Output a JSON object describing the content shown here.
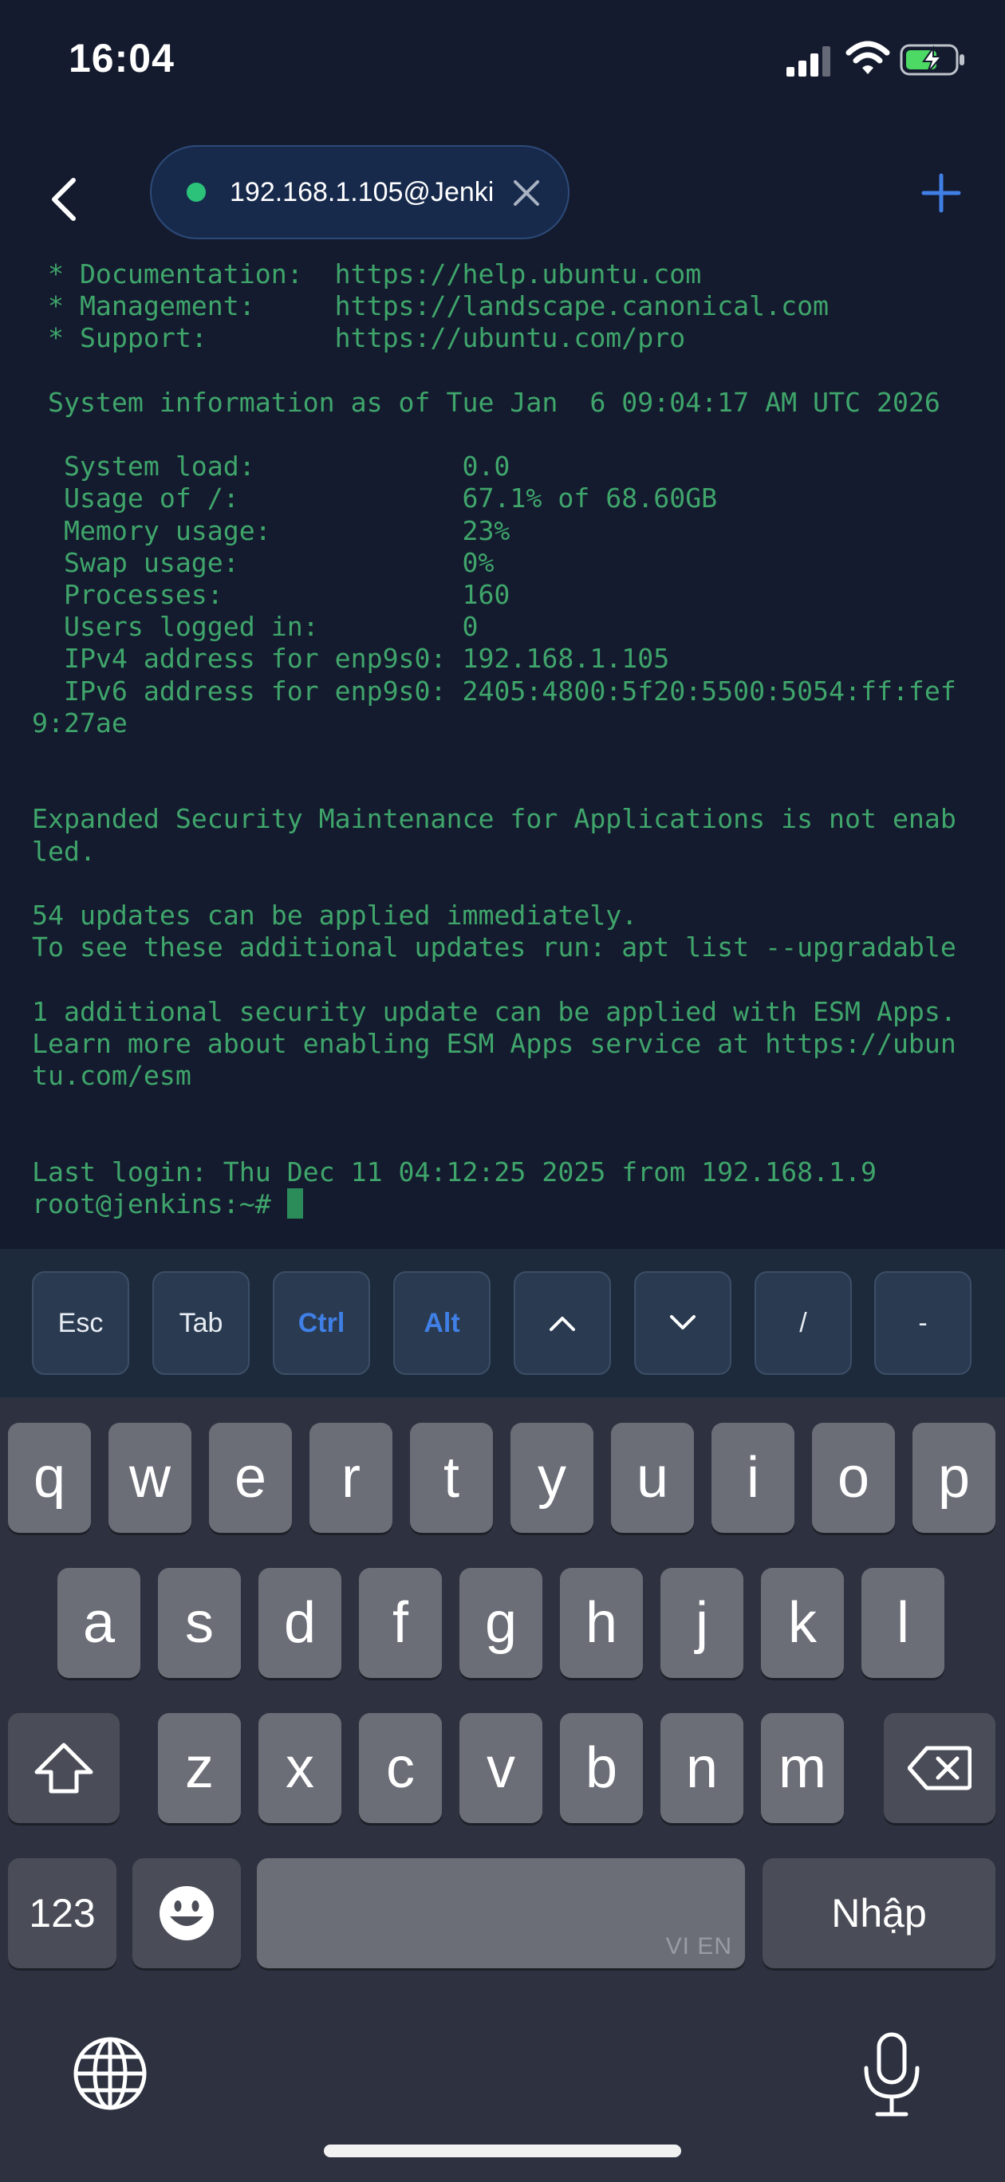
{
  "status_bar": {
    "time": "16:04",
    "icons": [
      "signal-icon",
      "wifi-icon",
      "battery-charging-icon"
    ]
  },
  "header": {
    "back_icon": "chevron-left-icon",
    "session_label": "192.168.1.105@Jenki",
    "session_status_color": "#2cc27a",
    "close_icon": "close-icon",
    "add_icon": "plus-icon"
  },
  "terminal": {
    "text_color": "#3fa56b",
    "lines": [
      " * Documentation:  https://help.ubuntu.com",
      " * Management:     https://landscape.canonical.com",
      " * Support:        https://ubuntu.com/pro",
      "",
      " System information as of Tue Jan  6 09:04:17 AM UTC 2026",
      "",
      "  System load:             0.0",
      "  Usage of /:              67.1% of 68.60GB",
      "  Memory usage:            23%",
      "  Swap usage:              0%",
      "  Processes:               160",
      "  Users logged in:         0",
      "  IPv4 address for enp9s0: 192.168.1.105",
      "  IPv6 address for enp9s0: 2405:4800:5f20:5500:5054:ff:fef",
      "9:27ae",
      "",
      "",
      "Expanded Security Maintenance for Applications is not enab",
      "led.",
      "",
      "54 updates can be applied immediately.",
      "To see these additional updates run: apt list --upgradable",
      "",
      "1 additional security update can be applied with ESM Apps.",
      "Learn more about enabling ESM Apps service at https://ubun",
      "tu.com/esm",
      "",
      "",
      "Last login: Thu Dec 11 04:12:25 2025 from 192.168.1.9"
    ],
    "prompt": "root@jenkins:~# "
  },
  "extra_keys": {
    "esc": "Esc",
    "tab": "Tab",
    "ctrl": "Ctrl",
    "alt": "Alt",
    "up_icon": "chevron-up-icon",
    "down_icon": "chevron-down-icon",
    "slash": "/",
    "dash": "-",
    "modifier_color": "#3f7fe6"
  },
  "keyboard": {
    "row1": [
      "q",
      "w",
      "e",
      "r",
      "t",
      "y",
      "u",
      "i",
      "o",
      "p"
    ],
    "row2": [
      "a",
      "s",
      "d",
      "f",
      "g",
      "h",
      "j",
      "k",
      "l"
    ],
    "row3": [
      "z",
      "x",
      "c",
      "v",
      "b",
      "n",
      "m"
    ],
    "numbers_label": "123",
    "space_hint": "VI EN",
    "enter_label": "Nhập",
    "icons": [
      "shift-icon",
      "backspace-icon",
      "emoji-icon",
      "globe-icon",
      "microphone-icon"
    ]
  }
}
